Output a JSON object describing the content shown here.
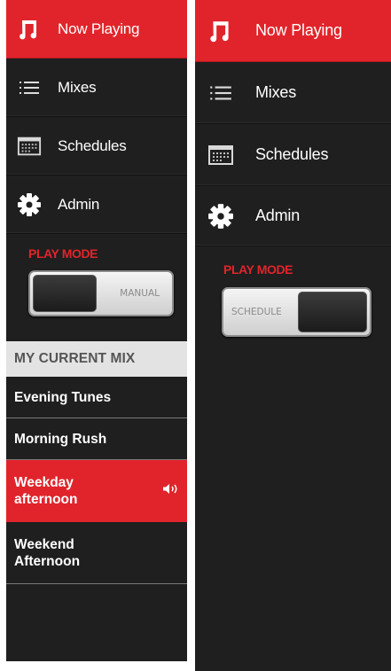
{
  "left_panel": {
    "nav": {
      "now_playing": "Now Playing",
      "mixes": "Mixes",
      "schedules": "Schedules",
      "admin": "Admin"
    },
    "play_mode": {
      "title": "PLAY MODE",
      "toggle_label": "MANUAL",
      "state": "manual"
    },
    "current_mix": {
      "header": "MY CURRENT MIX",
      "items": [
        {
          "name": "Evening Tunes",
          "active": false
        },
        {
          "name": "Morning Rush",
          "active": false
        },
        {
          "name": "Weekday\nafternoon",
          "active": true
        },
        {
          "name": "Weekend\nAfternoon",
          "active": false
        }
      ]
    }
  },
  "right_panel": {
    "nav": {
      "now_playing": "Now Playing",
      "mixes": "Mixes",
      "schedules": "Schedules",
      "admin": "Admin"
    },
    "play_mode": {
      "title": "PLAY MODE",
      "toggle_label": "SCHEDULE",
      "state": "schedule"
    }
  },
  "icons": {
    "now_playing": "music-note-icon",
    "mixes": "list-icon",
    "schedules": "calendar-icon",
    "admin": "gear-icon",
    "playing": "speaker-icon"
  },
  "colors": {
    "accent": "#e1242b",
    "panel_bg": "#1f1f1f",
    "header_bg": "#e3e3e3",
    "text": "#ffffff"
  }
}
